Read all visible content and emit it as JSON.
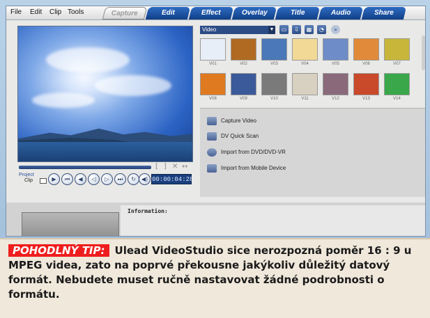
{
  "menu": [
    "File",
    "Edit",
    "Clip",
    "Tools"
  ],
  "tabs": [
    {
      "label": "Capture",
      "active": true
    },
    {
      "label": "Edit",
      "active": false
    },
    {
      "label": "Effect",
      "active": false
    },
    {
      "label": "Overlay",
      "active": false
    },
    {
      "label": "Title",
      "active": false
    },
    {
      "label": "Audio",
      "active": false
    },
    {
      "label": "Share",
      "active": false
    }
  ],
  "player": {
    "project_label": "Project",
    "clip_label": "Clip",
    "timecode": "00:00:04:28",
    "transport_icons": [
      "play-icon",
      "home-icon",
      "previous-icon",
      "step-back-icon",
      "step-forward-icon",
      "end-icon",
      "repeat-icon",
      "volume-icon"
    ],
    "trim_controls": [
      "[",
      "]",
      "✕",
      "↔"
    ]
  },
  "library": {
    "category": "Video",
    "toolbar_icons": [
      "folder-icon",
      "import-icon",
      "storyboard-icon",
      "options-icon",
      "expand-icon"
    ],
    "thumbnails": [
      {
        "label": "V01",
        "color": "#e8eef8"
      },
      {
        "label": "V02",
        "color": "#b06a22"
      },
      {
        "label": "V03",
        "color": "#4a78b8"
      },
      {
        "label": "V04",
        "color": "#f2d996"
      },
      {
        "label": "V05",
        "color": "#6e8cc8"
      },
      {
        "label": "V06",
        "color": "#e08a3a"
      },
      {
        "label": "V07",
        "color": "#c8b63a"
      },
      {
        "label": "V08",
        "color": "#e07a20"
      },
      {
        "label": "V09",
        "color": "#3a5a9a"
      },
      {
        "label": "V10",
        "color": "#7a7a7a"
      },
      {
        "label": "V11",
        "color": "#d8d0c0"
      },
      {
        "label": "V12",
        "color": "#8a6a7a"
      },
      {
        "label": "V13",
        "color": "#c84a2a"
      },
      {
        "label": "V14",
        "color": "#3aa84a"
      }
    ]
  },
  "capture_options": [
    "Capture Video",
    "DV Quick Scan",
    "Import from DVD/DVD-VR",
    "Import from Mobile Device"
  ],
  "info": {
    "label": "Information:"
  },
  "tip": {
    "tag": "POHODLNÝ TIP:",
    "text": "Ulead VideoStudio sice nerozpozná poměr 16 : 9 u MPEG videa, zato na poprvé překousne jakýkoliv důležitý datový formát. Nebudete muset ručně nastavovat žádné podrobnosti o formátu."
  }
}
